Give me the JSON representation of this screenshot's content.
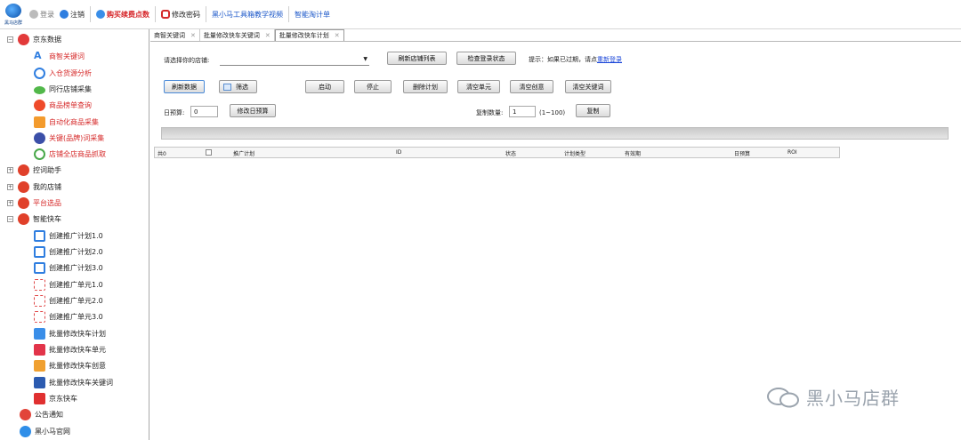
{
  "toolbar": {
    "logo_text": "黑马店群",
    "items": [
      "登录",
      "注销",
      "购买续费点数",
      "修改密码",
      "黑小马工具箱教学视频",
      "智能淘计单"
    ]
  },
  "sidebar": {
    "groups": [
      {
        "label": "京东数据",
        "expanded": true
      },
      {
        "label": "控词助手",
        "expanded": false
      },
      {
        "label": "我的店铺",
        "expanded": false
      },
      {
        "label": "平台选品",
        "expanded": false
      },
      {
        "label": "智能快车",
        "expanded": true
      }
    ],
    "jd_items": [
      "商智关键词",
      "入仓货源分析",
      "同行店铺采集",
      "商品榜单查询",
      "自动化商品采集",
      "关键(品牌)词采集",
      "店铺全店商品抓取"
    ],
    "kuaiche_items": [
      "创建推广计划1.0",
      "创建推广计划2.0",
      "创建推广计划3.0",
      "创建推广单元1.0",
      "创建推广单元2.0",
      "创建推广单元3.0",
      "批量修改快车计划",
      "批量修改快车单元",
      "批量修改快车创意",
      "批量修改快车关键词",
      "京东快车"
    ],
    "bottom_items": [
      "公告通知",
      "黑小马官网"
    ]
  },
  "tabs": [
    "商智关键词",
    "批量修改快车关键词",
    "批量修改快车计划"
  ],
  "form": {
    "shop_label": "请选择你的店铺:",
    "refresh_shop_btn": "刷新店铺列表",
    "check_login_btn": "检查登录状态",
    "tip_text": "提示：如果已过期，请点",
    "relogin_link": "重新登录",
    "refresh_data_btn": "刷新数据",
    "filter_btn": "筛选",
    "start_btn": "启动",
    "stop_btn": "停止",
    "delete_plan_btn": "删除计划",
    "clear_unit_btn": "清空单元",
    "clear_creative_btn": "清空创意",
    "clear_keyword_btn": "清空关键词",
    "daily_budget_label": "日预算:",
    "daily_budget_value": "0",
    "modify_budget_btn": "修改日预算",
    "copy_count_label": "复制数量:",
    "copy_count_value": "1",
    "copy_range": "(1~100)",
    "copy_btn": "复制"
  },
  "grid": {
    "total": "共0",
    "columns": [
      "推广计划",
      "ID",
      "状态",
      "计划类型",
      "有效期",
      "日预算",
      "ROI"
    ]
  },
  "watermark": "黑小马店群"
}
